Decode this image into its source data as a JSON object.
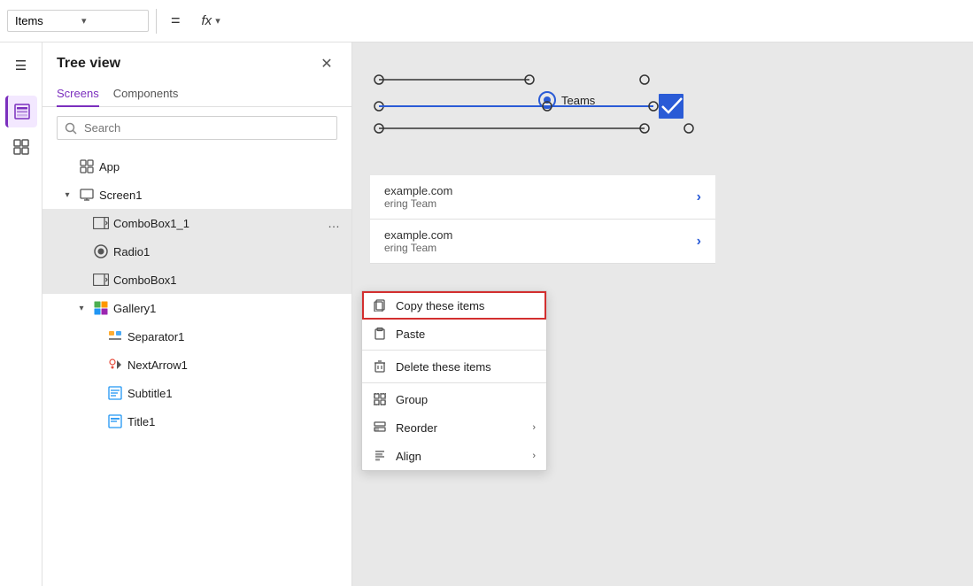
{
  "topbar": {
    "selector_label": "Items",
    "selector_dropdown_icon": "▾",
    "equals_icon": "=",
    "fx_label": "fx",
    "fx_dropdown_icon": "▾"
  },
  "icon_rail": {
    "items": [
      {
        "name": "hamburger-menu",
        "icon": "☰",
        "active": false
      },
      {
        "name": "layers",
        "icon": "⊞",
        "active": true
      },
      {
        "name": "components",
        "icon": "⬡",
        "active": false
      }
    ]
  },
  "tree_panel": {
    "title": "Tree view",
    "close_icon": "✕",
    "tabs": [
      {
        "label": "Screens",
        "active": true
      },
      {
        "label": "Components",
        "active": false
      }
    ],
    "search_placeholder": "Search",
    "items": [
      {
        "id": "app",
        "label": "App",
        "indent": 0,
        "has_chevron": false,
        "icon_type": "app",
        "selected": false
      },
      {
        "id": "screen1",
        "label": "Screen1",
        "indent": 0,
        "has_chevron": true,
        "chevron_dir": "down",
        "icon_type": "screen",
        "selected": false
      },
      {
        "id": "combobox1_1",
        "label": "ComboBox1_1",
        "indent": 1,
        "has_chevron": false,
        "icon_type": "combobox",
        "selected": true,
        "has_more": true
      },
      {
        "id": "radio1",
        "label": "Radio1",
        "indent": 1,
        "has_chevron": false,
        "icon_type": "radio",
        "selected": true
      },
      {
        "id": "combobox1",
        "label": "ComboBox1",
        "indent": 1,
        "has_chevron": false,
        "icon_type": "combobox",
        "selected": true
      },
      {
        "id": "gallery1",
        "label": "Gallery1",
        "indent": 1,
        "has_chevron": true,
        "chevron_dir": "down",
        "icon_type": "gallery",
        "selected": false
      },
      {
        "id": "separator1",
        "label": "Separator1",
        "indent": 2,
        "has_chevron": false,
        "icon_type": "separator",
        "selected": false
      },
      {
        "id": "nextarrow1",
        "label": "NextArrow1",
        "indent": 2,
        "has_chevron": false,
        "icon_type": "nextarrow",
        "selected": false
      },
      {
        "id": "subtitle1",
        "label": "Subtitle1",
        "indent": 2,
        "has_chevron": false,
        "icon_type": "text",
        "selected": false
      },
      {
        "id": "title1",
        "label": "Title1",
        "indent": 2,
        "has_chevron": false,
        "icon_type": "text",
        "selected": false
      }
    ]
  },
  "context_menu": {
    "items": [
      {
        "id": "copy",
        "label": "Copy these items",
        "icon": "copy",
        "has_arrow": false,
        "highlighted": true
      },
      {
        "id": "paste",
        "label": "Paste",
        "icon": "paste",
        "has_arrow": false,
        "highlighted": false
      },
      {
        "id": "delete",
        "label": "Delete these items",
        "icon": "delete",
        "has_arrow": false,
        "highlighted": false
      },
      {
        "id": "group",
        "label": "Group",
        "icon": "group",
        "has_arrow": false,
        "highlighted": false
      },
      {
        "id": "reorder",
        "label": "Reorder",
        "icon": "reorder",
        "has_arrow": true,
        "highlighted": false
      },
      {
        "id": "align",
        "label": "Align",
        "icon": "align",
        "has_arrow": true,
        "highlighted": false
      }
    ]
  },
  "canvas": {
    "radio_label": "Teams",
    "list_items": [
      {
        "title": "example.com",
        "subtitle": "ering Team"
      },
      {
        "title": "example.com",
        "subtitle": "ering Team"
      }
    ]
  }
}
